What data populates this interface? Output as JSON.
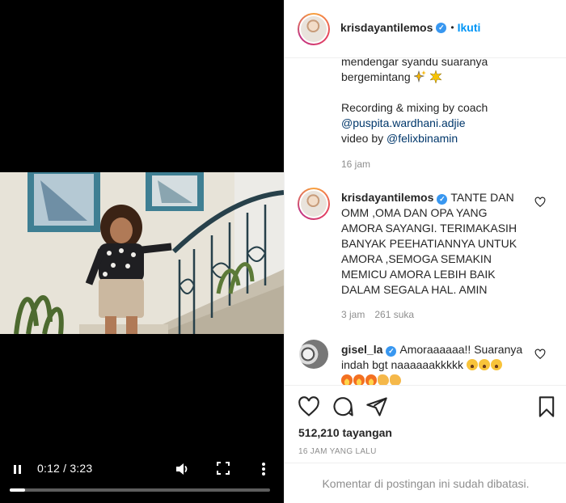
{
  "post": {
    "username": "krisdayantilemos",
    "follow_label": "Ikuti",
    "separator": "•"
  },
  "caption": {
    "line1": "mendengar syandu suaranya",
    "line2": "bergemintang",
    "line3": "Recording & mixing by coach",
    "mention1": "@puspita.wardhani.adjie",
    "line5_prefix": "video by ",
    "mention2": "@felixbinamin",
    "time": "16 jam"
  },
  "comments": [
    {
      "username": "krisdayantilemos",
      "text": "TANTE DAN OMM ,OMA DAN OPA YANG AMORA SAYANGI. TERIMAKASIH BANYAK PEEHATIANNYA UNTUK AMORA ,SEMOGA SEMAKIN MEMICU AMORA LEBIH BAIK DALAM SEGALA HAL. AMIN",
      "time": "3 jam",
      "likes": "261 suka"
    },
    {
      "username": "gisel_la",
      "text": "Amoraaaaaa!! Suaranya indah bgt naaaaaakkkkk"
    }
  ],
  "video": {
    "time": "0:12 / 3:23",
    "progress": 0.06
  },
  "stats": {
    "views": "512,210 tayangan",
    "posted": "16 JAM YANG LALU"
  },
  "footer": {
    "comments_disabled": "Komentar di postingan ini sudah dibatasi."
  },
  "icons": {
    "pause": "pause-icon",
    "volume": "volume-icon",
    "fullscreen": "fullscreen-icon",
    "more": "more-vertical-icon",
    "like": "heart-icon",
    "comment": "comment-icon",
    "share": "share-icon",
    "save": "bookmark-icon",
    "verified": "verified-badge-icon"
  },
  "colors": {
    "accent": "#0095f6",
    "verified": "#3897f0",
    "mention": "#00376b",
    "muted": "#8e8e8e"
  }
}
